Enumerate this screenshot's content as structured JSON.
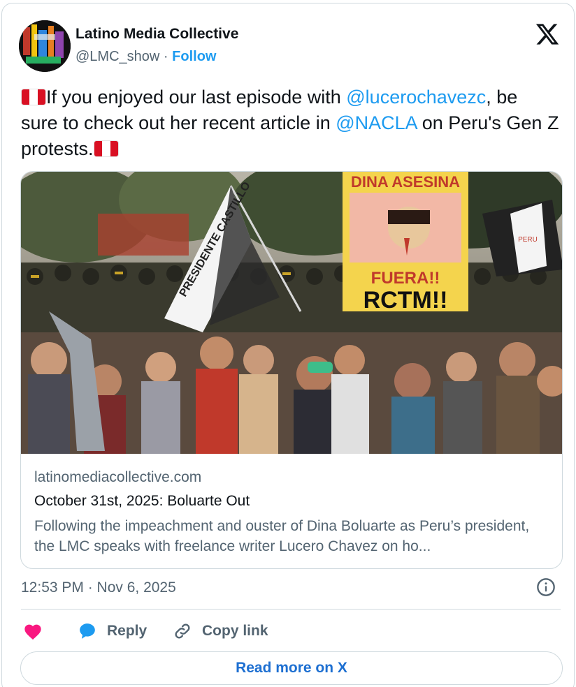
{
  "author": {
    "name": "Latino Media Collective",
    "handle": "@LMC_show",
    "separator": "·",
    "follow_label": "Follow"
  },
  "tweet": {
    "text_part1": "If you enjoyed our last episode with ",
    "mention1": "@lucerochavezc",
    "text_part2": ", be sure to check out her recent article in ",
    "mention2": "@NACLA",
    "text_part3": " on Peru's Gen Z protests."
  },
  "link_card": {
    "image_signs": {
      "sign_top": "DINA ASESINA",
      "sign_mid": "FUERA!!",
      "sign_bottom": "RCTM!!",
      "flag_text": "PRESIDENTE CASTILLO",
      "flag_small": "PERU"
    },
    "domain": "latinomediacollective.com",
    "title": "October 31st, 2025: Boluarte Out",
    "description": "Following the impeachment and ouster of Dina Boluarte as Peru’s president, the LMC speaks with freelance writer Lucero Chavez on ho..."
  },
  "timestamp": "12:53 PM · Nov 6, 2025",
  "actions": {
    "reply_label": "Reply",
    "copy_label": "Copy link"
  },
  "read_more_label": "Read more on X",
  "colors": {
    "accent": "#1d9bf0",
    "heart": "#f91880",
    "reply": "#1d9bf0",
    "muted": "#536471"
  }
}
